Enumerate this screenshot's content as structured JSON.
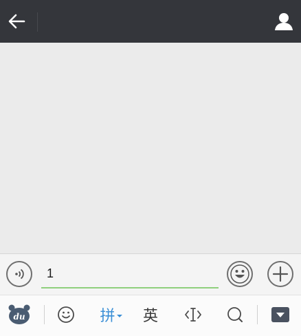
{
  "header": {
    "back_icon": "arrow-left-icon",
    "profile_icon": "person-icon"
  },
  "composer": {
    "voice_icon": "voice-wave-icon",
    "input_value": "1",
    "emoji_icon": "smiley-icon",
    "plus_icon": "plus-icon",
    "underline_color": "#8fcf7c"
  },
  "ime_toolbar": {
    "logo_text": "du",
    "emoji_icon": "smiley-outline-icon",
    "pinyin_label": "拼",
    "english_label": "英",
    "cursor_icon": "text-cursor-icon",
    "search_icon": "search-icon",
    "hide_icon": "keyboard-hide-icon",
    "active_color": "#3b8fd6"
  }
}
